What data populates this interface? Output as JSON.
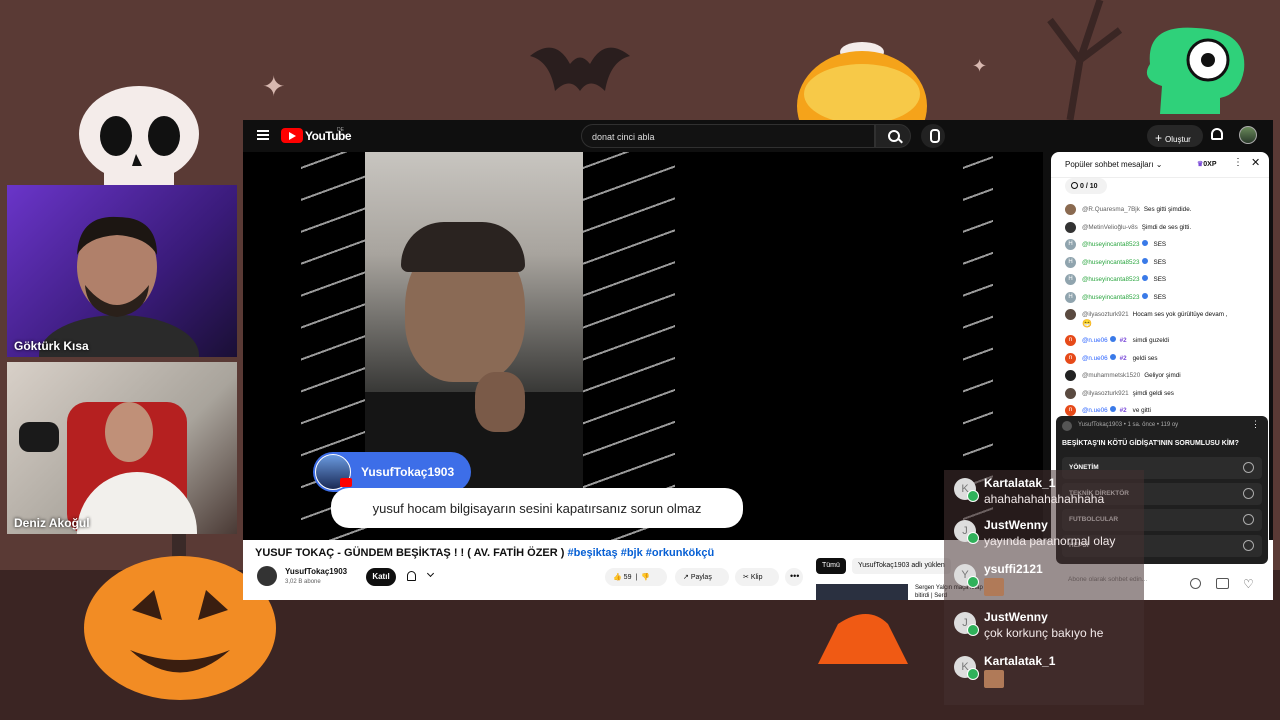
{
  "cams": [
    {
      "name": "Göktürk Kısa"
    },
    {
      "name": "Deniz Akoğul"
    }
  ],
  "youtube": {
    "brand": "YouTube",
    "region": "DE",
    "search_value": "donat cinci abla",
    "create_label": "Oluştur",
    "video": {
      "caption_name": "YusufTokaç1903",
      "caption_message": "yusuf hocam bilgisayarın sesini kapatırsanız sorun olmaz"
    },
    "info": {
      "title": "YUSUF TOKAÇ - GÜNDEM BEŞİKTAŞ ! ! ( AV. FATİH ÖZER )",
      "hashtags": "#beşiktaş #bjk #orkunkökçü",
      "channel_name": "YusufTokaç1903",
      "subscribers": "3,02 B abone",
      "join_label": "Katıl",
      "likes": "59",
      "share_label": "Paylaş",
      "clip_label": "Klip",
      "more_label": "•••"
    },
    "recommendations": {
      "tab_all": "Tümü",
      "tab_channel": "YusufTokaç1903 adlı yüklen",
      "first_title": "Sergen Yalçın maça kitap bitirdi | Serd"
    }
  },
  "chat": {
    "title": "Popüler sohbet mesajları",
    "xp": "0XP",
    "goal": "0 / 10",
    "messages": [
      {
        "author": "@R.Quaresma_7Bjk",
        "text": "Ses gitti şimdide.",
        "color": "#8a6a50",
        "initial": ""
      },
      {
        "author": "@MetinVelioğlu-v8s",
        "text": "Şimdi de ses gitti.",
        "color": "#333333",
        "initial": ""
      },
      {
        "author": "@huseyincanta8523",
        "text": "SES",
        "color": "#90a4ae",
        "initial": "H"
      },
      {
        "author": "@huseyincanta8523",
        "text": "SES",
        "color": "#90a4ae",
        "initial": "H"
      },
      {
        "author": "@huseyincanta8523",
        "text": "SES",
        "color": "#90a4ae",
        "initial": "H"
      },
      {
        "author": "@huseyincanta8523",
        "text": "SES",
        "color": "#90a4ae",
        "initial": "H"
      },
      {
        "author": "@ilyasozturk921",
        "text": "Hocam ses yok gürültüye devam ,",
        "color": "#5a4a40",
        "initial": ""
      },
      {
        "author": "@n.ue06",
        "text": "simdi guzeldi",
        "color": "#e64a19",
        "initial": "n"
      },
      {
        "author": "@n.ue06",
        "text": "geldi ses",
        "color": "#e64a19",
        "initial": "n"
      },
      {
        "author": "@muhammetsk1520",
        "text": "Geliyor şimdi",
        "color": "#222222",
        "initial": ""
      },
      {
        "author": "@ilyasozturk921",
        "text": "şimdi geldi ses",
        "color": "#5a4a40",
        "initial": ""
      },
      {
        "author": "@n.ue06",
        "text": "ve gitti",
        "color": "#e64a19",
        "initial": "n"
      }
    ],
    "member_badge": "#2",
    "poll": {
      "header": "YusufTokaç1903 • 1 sa. önce • 119 oy",
      "question": "BEŞİKTAŞ'IN KÖTÜ GİDİŞAT'ININ SORUMLUSU KİM?",
      "options": [
        "YÖNETİM",
        "TEKNİK DİREKTÖR",
        "FUTBOLCULAR",
        "HEPSİ"
      ]
    },
    "input_placeholder": "Abone olarak sohbet edin..."
  },
  "twitch_chat": [
    {
      "name": "Kartalatak_1",
      "text": "ahahahahahahahhaha",
      "initial": "K"
    },
    {
      "name": "JustWenny",
      "text": "yayında paranormal olay",
      "initial": "J"
    },
    {
      "name": "ysuffi2121",
      "text": "",
      "initial": "Y"
    },
    {
      "name": "JustWenny",
      "text": "çok korkunç bakıyo he",
      "initial": "J"
    },
    {
      "name": "Kartalatak_1",
      "text": "",
      "initial": "K"
    }
  ]
}
